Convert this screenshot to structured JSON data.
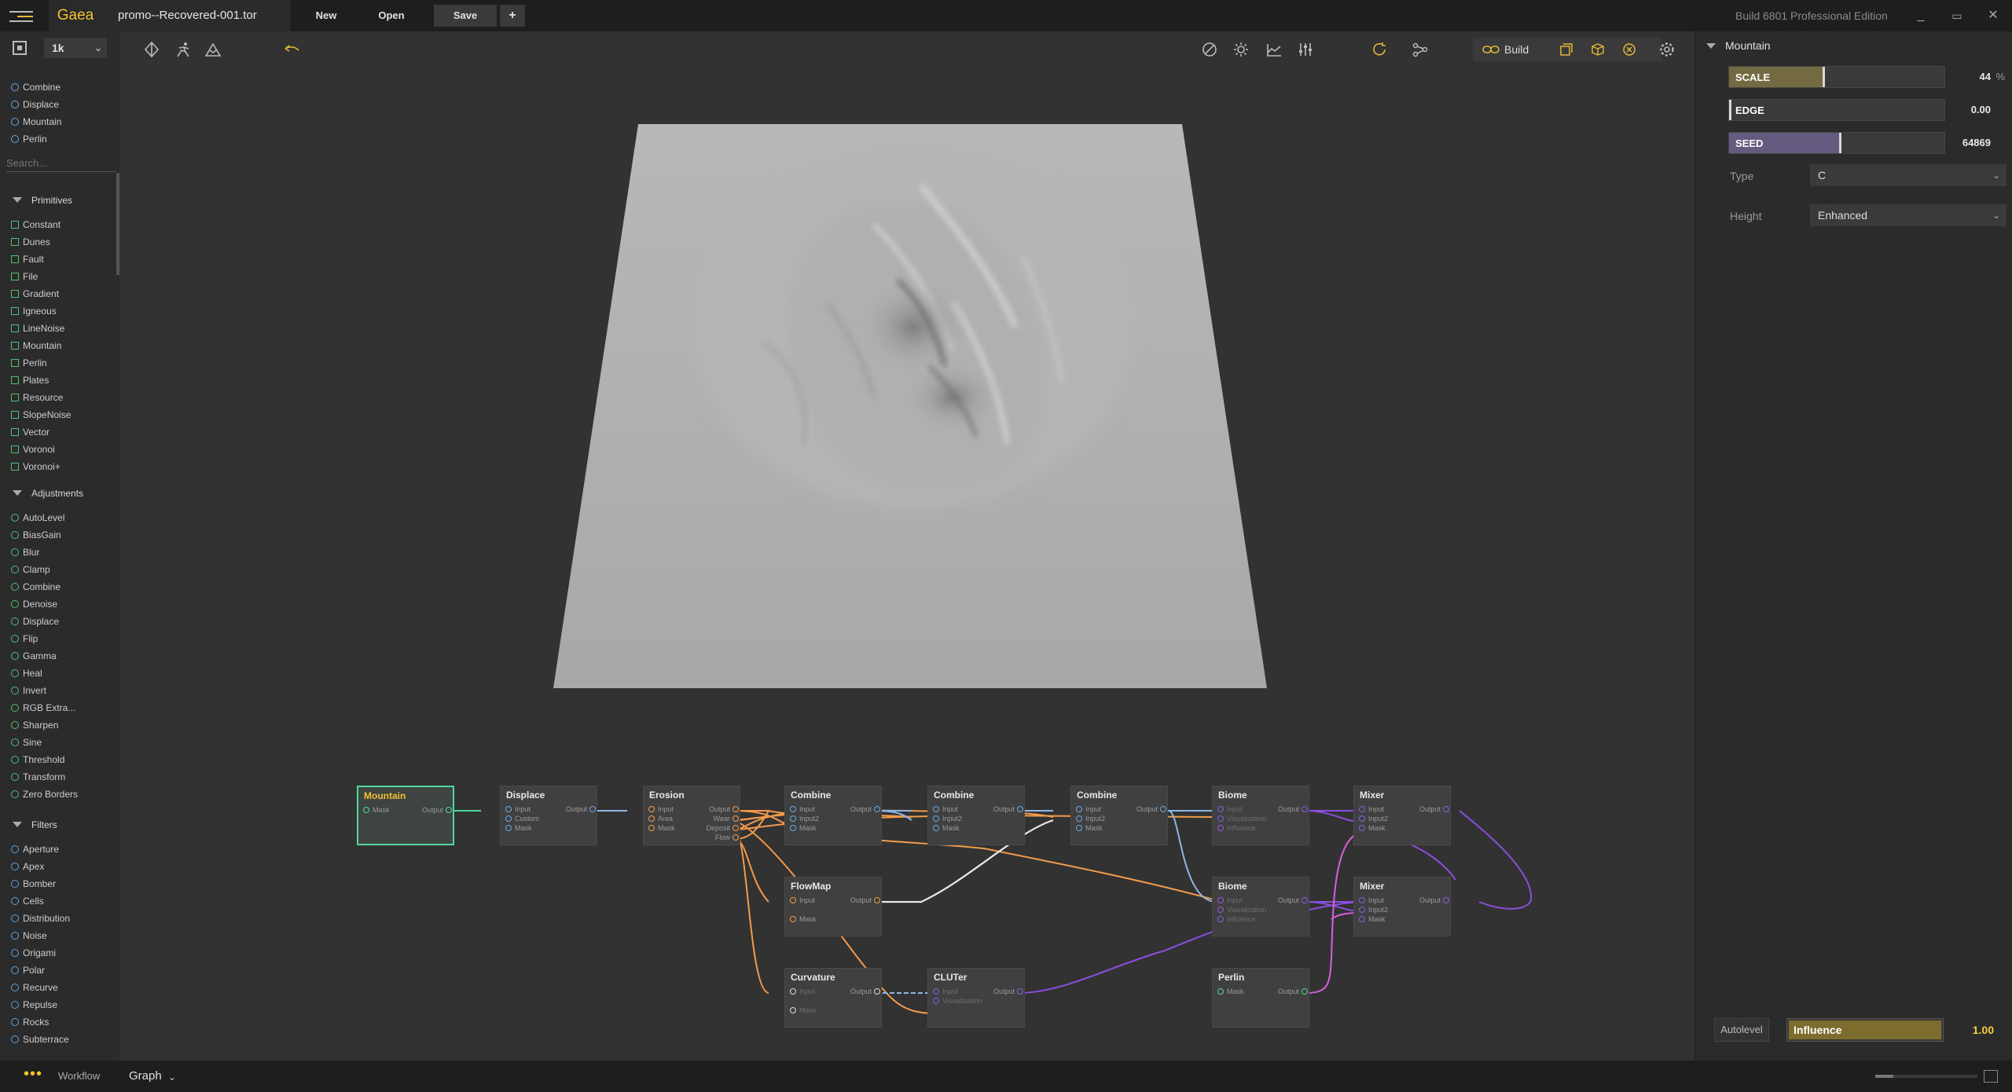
{
  "titlebar": {
    "app_name": "Gaea",
    "file_name": "promo--Recovered-001.tor",
    "new_label": "New",
    "open_label": "Open",
    "save_label": "Save",
    "plus_label": "+",
    "build_info": "Build 6801 Professional Edition",
    "min_glyph": "_",
    "max_glyph": "▭",
    "close_glyph": "✕"
  },
  "toolbar_left": {
    "resolution": "1k",
    "search_placeholder": "Search..."
  },
  "recent_nodes": [
    "Combine",
    "Displace",
    "Mountain",
    "Perlin"
  ],
  "library": {
    "primitives_label": "Primitives",
    "primitives": [
      "Constant",
      "Dunes",
      "Fault",
      "File",
      "Gradient",
      "Igneous",
      "LineNoise",
      "Mountain",
      "Perlin",
      "Plates",
      "Resource",
      "SlopeNoise",
      "Vector",
      "Voronoi",
      "Voronoi+"
    ],
    "adjustments_label": "Adjustments",
    "adjustments": [
      "AutoLevel",
      "BiasGain",
      "Blur",
      "Clamp",
      "Combine",
      "Denoise",
      "Displace",
      "Flip",
      "Gamma",
      "Heal",
      "Invert",
      "RGB Extra...",
      "Sharpen",
      "Sine",
      "Threshold",
      "Transform",
      "Zero Borders"
    ],
    "filters_label": "Filters",
    "filters": [
      "Aperture",
      "Apex",
      "Bomber",
      "Cells",
      "Distribution",
      "Noise",
      "Origami",
      "Polar",
      "Recurve",
      "Repulse",
      "Rocks",
      "Subterrace"
    ]
  },
  "toolbar_main": {
    "build_label": "Build"
  },
  "graph": {
    "nodes": [
      {
        "title": "Mountain",
        "inputs": [
          "Mask"
        ],
        "outputs": [
          "Output"
        ]
      },
      {
        "title": "Displace",
        "inputs": [
          "Input",
          "Custom",
          "Mask"
        ],
        "outputs": [
          "Output"
        ]
      },
      {
        "title": "Erosion",
        "inputs": [
          "Input",
          "Area",
          "Mask"
        ],
        "outputs": [
          "Output",
          "Wear",
          "Deposit",
          "Flow"
        ]
      },
      {
        "title": "Combine",
        "inputs": [
          "Input",
          "Input2",
          "Mask"
        ],
        "outputs": [
          "Output"
        ]
      },
      {
        "title": "Combine",
        "inputs": [
          "Input",
          "Input2",
          "Mask"
        ],
        "outputs": [
          "Output"
        ]
      },
      {
        "title": "Combine",
        "inputs": [
          "Input",
          "Input2",
          "Mask"
        ],
        "outputs": [
          "Output"
        ]
      },
      {
        "title": "Biome",
        "inputs": [
          "Input",
          "Visualization",
          "Influence"
        ],
        "outputs": [
          "Output"
        ]
      },
      {
        "title": "Mixer",
        "inputs": [
          "Input",
          "Input2",
          "Mask"
        ],
        "outputs": [
          "Output"
        ]
      },
      {
        "title": "FlowMap",
        "inputs": [
          "Input",
          "Mask"
        ],
        "outputs": [
          "Output"
        ]
      },
      {
        "title": "Biome",
        "inputs": [
          "Input",
          "Visualization",
          "Influence"
        ],
        "outputs": [
          "Output"
        ]
      },
      {
        "title": "Mixer",
        "inputs": [
          "Input",
          "Input2",
          "Mask"
        ],
        "outputs": [
          "Output"
        ]
      },
      {
        "title": "Curvature",
        "inputs": [
          "Input",
          "Mask"
        ],
        "outputs": [
          "Output"
        ]
      },
      {
        "title": "CLUTer",
        "inputs": [
          "Input",
          "Visualization"
        ],
        "outputs": [
          "Output"
        ]
      },
      {
        "title": "Perlin",
        "inputs": [
          "Mask"
        ],
        "outputs": [
          "Output"
        ]
      }
    ]
  },
  "properties": {
    "node_name": "Mountain",
    "scale_label": "SCALE",
    "scale_value": "44",
    "scale_unit": "%",
    "scale_fraction": 0.44,
    "edge_label": "EDGE",
    "edge_value": "0.00",
    "edge_fraction": 0.0,
    "seed_label": "SEED",
    "seed_value": "64869",
    "seed_fraction": 0.52,
    "type_label": "Type",
    "type_value": "C",
    "height_label": "Height",
    "height_value": "Enhanced",
    "autolevel_label": "Autolevel",
    "influence_label": "Influence",
    "influence_value": "1.00",
    "influence_fraction": 1.0
  },
  "statusbar": {
    "dots": "•••",
    "workflow_label": "Workflow",
    "graph_label": "Graph"
  },
  "colors": {
    "accent": "#f2c230",
    "selected_node": "#52d6a0",
    "wire_orange": "#f39b4a",
    "wire_blue": "#8fb7e6",
    "wire_purple": "#8a4fe0",
    "wire_pink": "#d85fe0",
    "wire_green": "#4fd99a"
  }
}
